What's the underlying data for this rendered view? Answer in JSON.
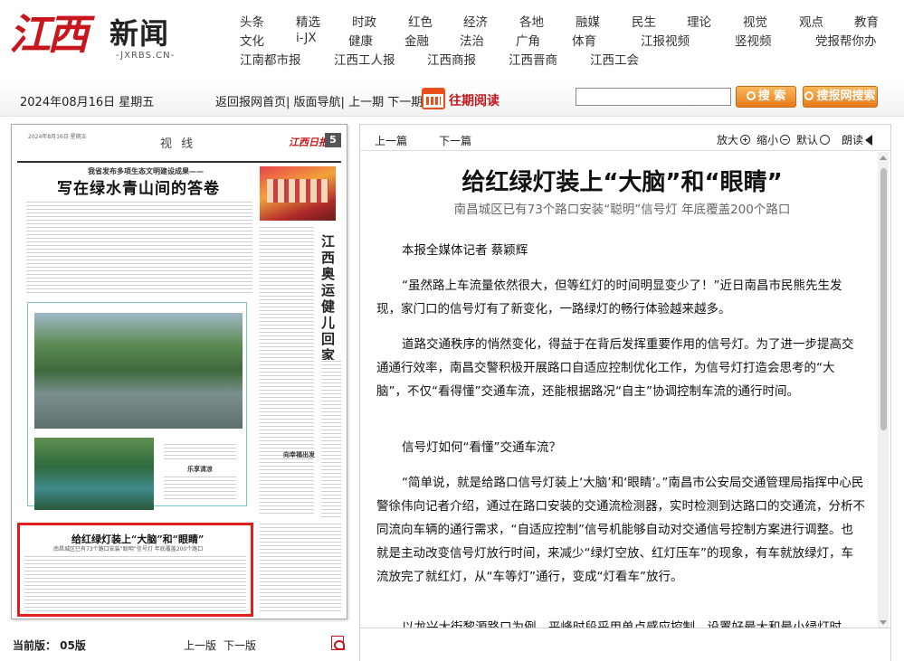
{
  "logo": {
    "calligraphy": "江西",
    "word": "新闻",
    "domain": "-JXRBS.CN-"
  },
  "nav": {
    "row1": [
      "头条",
      "精选",
      "时政",
      "红色",
      "经济",
      "各地",
      "融媒",
      "民生",
      "理论",
      "视觉",
      "观点",
      "教育"
    ],
    "row2": [
      "文化",
      "i-JX",
      "健康",
      "金融",
      "法治",
      "广角",
      "体育",
      "江报视频",
      "竖视频",
      "党报帮你办"
    ],
    "row3": [
      "江南都市报",
      "江西工人报",
      "江西商报",
      "江西晋商",
      "江西工会"
    ]
  },
  "toolbar": {
    "date": "2024年08月16日 星期五",
    "links": [
      "返回报网首页|",
      "版面导航|",
      "上一期",
      "下一期|"
    ],
    "archive": "往期阅读",
    "search_label": "搜 索",
    "site_search_label": "搜报网搜索"
  },
  "paper": {
    "date_line": "2024年8月16日 星期五",
    "section": "视 线",
    "masthead": "江西日报",
    "page_number": "5",
    "kicker": "我省发布多项生态文明建设成果——",
    "title1": "写在绿水青山间的答卷",
    "vertical_title": "江西奥运健儿回家啦",
    "caption1": "乐享清凉",
    "caption2": "向幸福出发",
    "title2": "给红绿灯装上“大脑”和“眼睛”",
    "sub2": "南昌城区已有73个路口安装“聪明”信号灯 年底覆盖200个路口"
  },
  "pager": {
    "current": "当前版：  05版",
    "prev": "上一版",
    "next": "下一版"
  },
  "article_toolbar": {
    "prev": "上一篇",
    "next": "下一篇",
    "zoom_in": "放大",
    "zoom_out": "缩小",
    "default": "默认",
    "read": "朗读"
  },
  "article": {
    "title": "给红绿灯装上“大脑”和“眼睛”",
    "subtitle": "南昌城区已有73个路口安装“聪明”信号灯 年底覆盖200个路口",
    "paragraphs": [
      "本报全媒体记者 蔡颖辉",
      "“虽然路上车流量依然很大，但等红灯的时间明显变少了！”近日南昌市民熊先生发现，家门口的信号灯有了新变化，一路绿灯的畅行体验越来越多。",
      "道路交通秩序的悄然变化，得益于在背后发挥重要作用的信号灯。为了进一步提高交通通行效率，南昌交警积极开展路口自适应控制优化工作，为信号灯打造会思考的“大脑”，不仅“看得懂”交通车流，还能根据路况“自主”协调控制车流的通行时间。",
      "信号灯如何“看懂”交通车流？",
      "“简单说，就是给路口信号灯装上‘大脑’和‘眼睛’。”南昌市公安局交通管理局指挥中心民警徐伟向记者介绍，通过在路口安装的交通流检测器，实时检测到达路口的交通流，分析不同流向车辆的通行需求，“自适应控制”信号机能够自动对交通信号控制方案进行调整。也就是主动改变信号灯放行时间，来减少“绿灯空放、红灯压车”的现象，有车就放绿灯，车流放完了就红灯，从“车等灯”通行，变成“灯看车”放行。",
      "以龙兴大街黎源路口为例，平峰时段采用单点感应控制，设置好最大和最小绿灯时"
    ]
  },
  "colors": {
    "brand_red": "#c8161d",
    "button_orange": "#e7791b",
    "highlight": "#e21d1d"
  }
}
